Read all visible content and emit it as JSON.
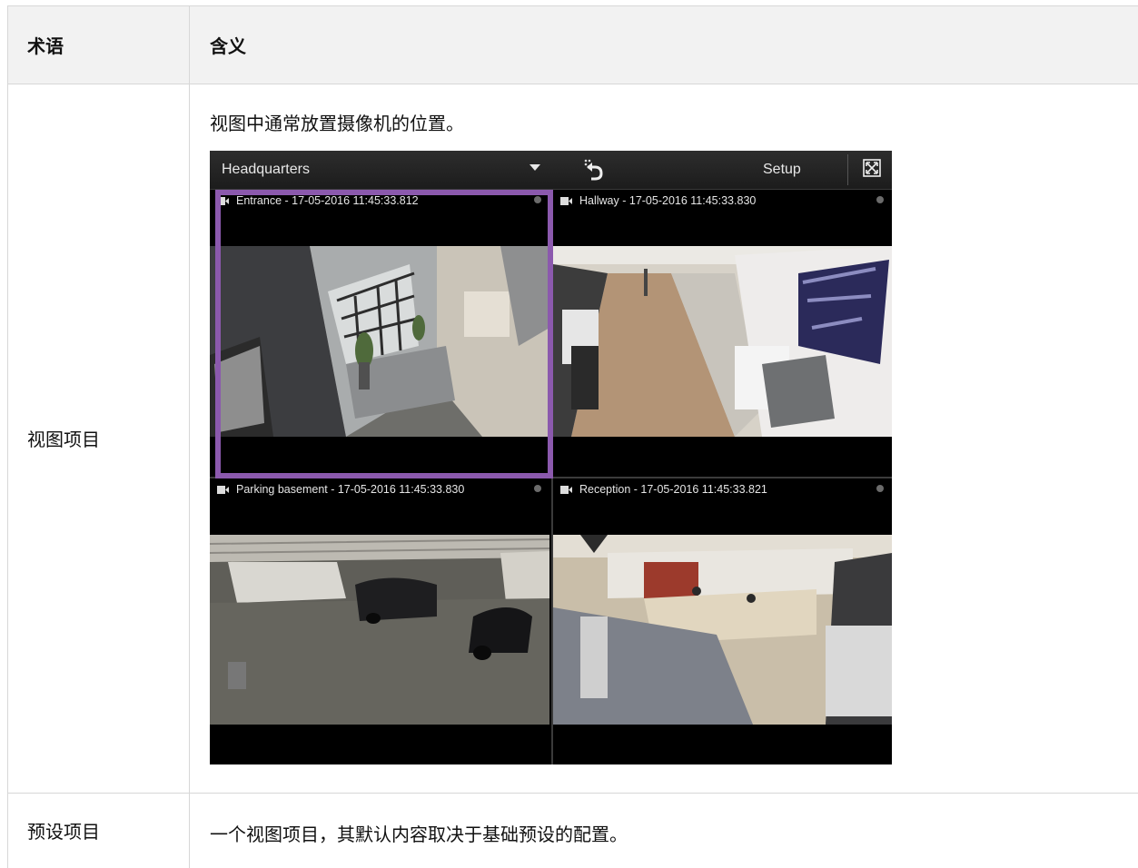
{
  "table": {
    "headers": {
      "term": "术语",
      "meaning": "含义"
    },
    "rows": [
      {
        "term": "视图项目",
        "description": "视图中通常放置摄像机的位置。"
      },
      {
        "term": "预设项目",
        "description": "一个视图项目，其默认内容取决于基础预设的配置。"
      }
    ]
  },
  "screenshot": {
    "view_name": "Headquarters",
    "setup_label": "Setup",
    "icons": {
      "dropdown": "chevron-down-icon",
      "undo": "undo-icon",
      "fullscreen": "fullscreen-icon",
      "camera": "camera-icon"
    },
    "selected_color": "#8b59ad",
    "cameras": [
      {
        "title": "Entrance - 17-05-2016 11:45:33.812",
        "selected": true
      },
      {
        "title": "Hallway - 17-05-2016 11:45:33.830",
        "selected": false
      },
      {
        "title": "Parking basement - 17-05-2016 11:45:33.830",
        "selected": false
      },
      {
        "title": "Reception - 17-05-2016 11:45:33.821",
        "selected": false
      }
    ]
  }
}
